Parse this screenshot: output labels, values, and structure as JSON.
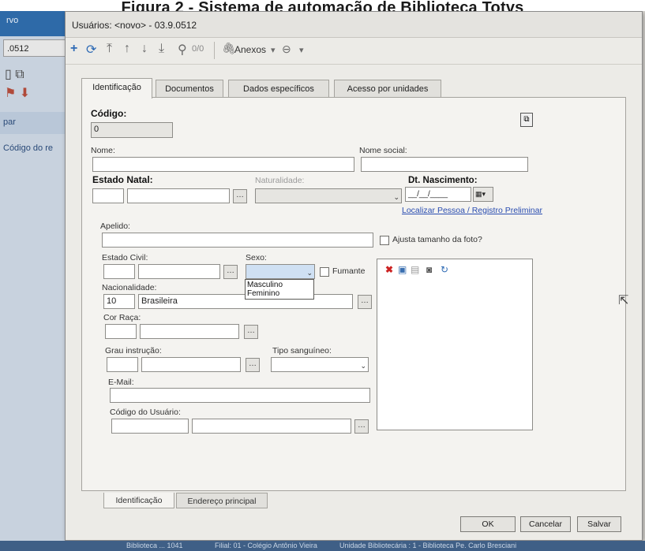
{
  "caption": "Figura 2 - Sistema de automação de Biblioteca Totvs",
  "left_pane": {
    "tab_label": "rvo",
    "code_value": ".0512",
    "band_label": "par",
    "item_label": "Código do re"
  },
  "status_bar": {
    "items": [
      "Biblioteca ... 1041",
      "Filial: 01 - Colégio Antônio Vieira",
      "Unidade Bibliotecária : 1 - Biblioteca Pe. Carlo Bresciani"
    ]
  },
  "window": {
    "title": "Usuários: <novo> - 03.9.0512"
  },
  "toolbar": {
    "counter": "0/0",
    "attachments_label": "Anexos"
  },
  "tabs": [
    {
      "label": "Identificação",
      "active": true
    },
    {
      "label": "Documentos",
      "active": false
    },
    {
      "label": "Dados específicos",
      "active": false
    },
    {
      "label": "Acesso por unidades",
      "active": false
    }
  ],
  "form": {
    "codigo_label": "Código:",
    "codigo_value": "0",
    "nome_label": "Nome:",
    "nome_social_label": "Nome social:",
    "estado_natal_label": "Estado Natal:",
    "naturalidade_label": "Naturalidade:",
    "dt_nascimento_label": "Dt. Nascimento:",
    "dt_nascimento_value": "__/__/____",
    "localizar_link": "Localizar Pessoa / Registro Preliminar",
    "apelido_label": "Apelido:",
    "ajusta_label": "Ajusta tamanho da foto?",
    "estado_civil_label": "Estado Civil:",
    "sexo_label": "Sexo:",
    "fumante_label": "Fumante",
    "nacionalidade_label": "Nacionalidade:",
    "nacionalidade_code": "10",
    "nacionalidade_value": "Brasileira",
    "cor_raca_label": "Cor Raça:",
    "grau_instrucao_label": "Grau instrução:",
    "tipo_sanguineo_label": "Tipo sanguíneo:",
    "email_label": "E-Mail:",
    "codigo_usuario_label": "Código do Usuário:"
  },
  "sexo_options": [
    "Masculino",
    "Feminino"
  ],
  "subtabs": [
    {
      "label": "Identificação",
      "active": true
    },
    {
      "label": "Endereço principal",
      "active": false
    }
  ],
  "buttons": {
    "ok": "OK",
    "cancel": "Cancelar",
    "save": "Salvar"
  },
  "colors": {
    "delete_icon": "#cc2222",
    "link": "#2a4db0",
    "left_tab": "#2e6aa8"
  }
}
